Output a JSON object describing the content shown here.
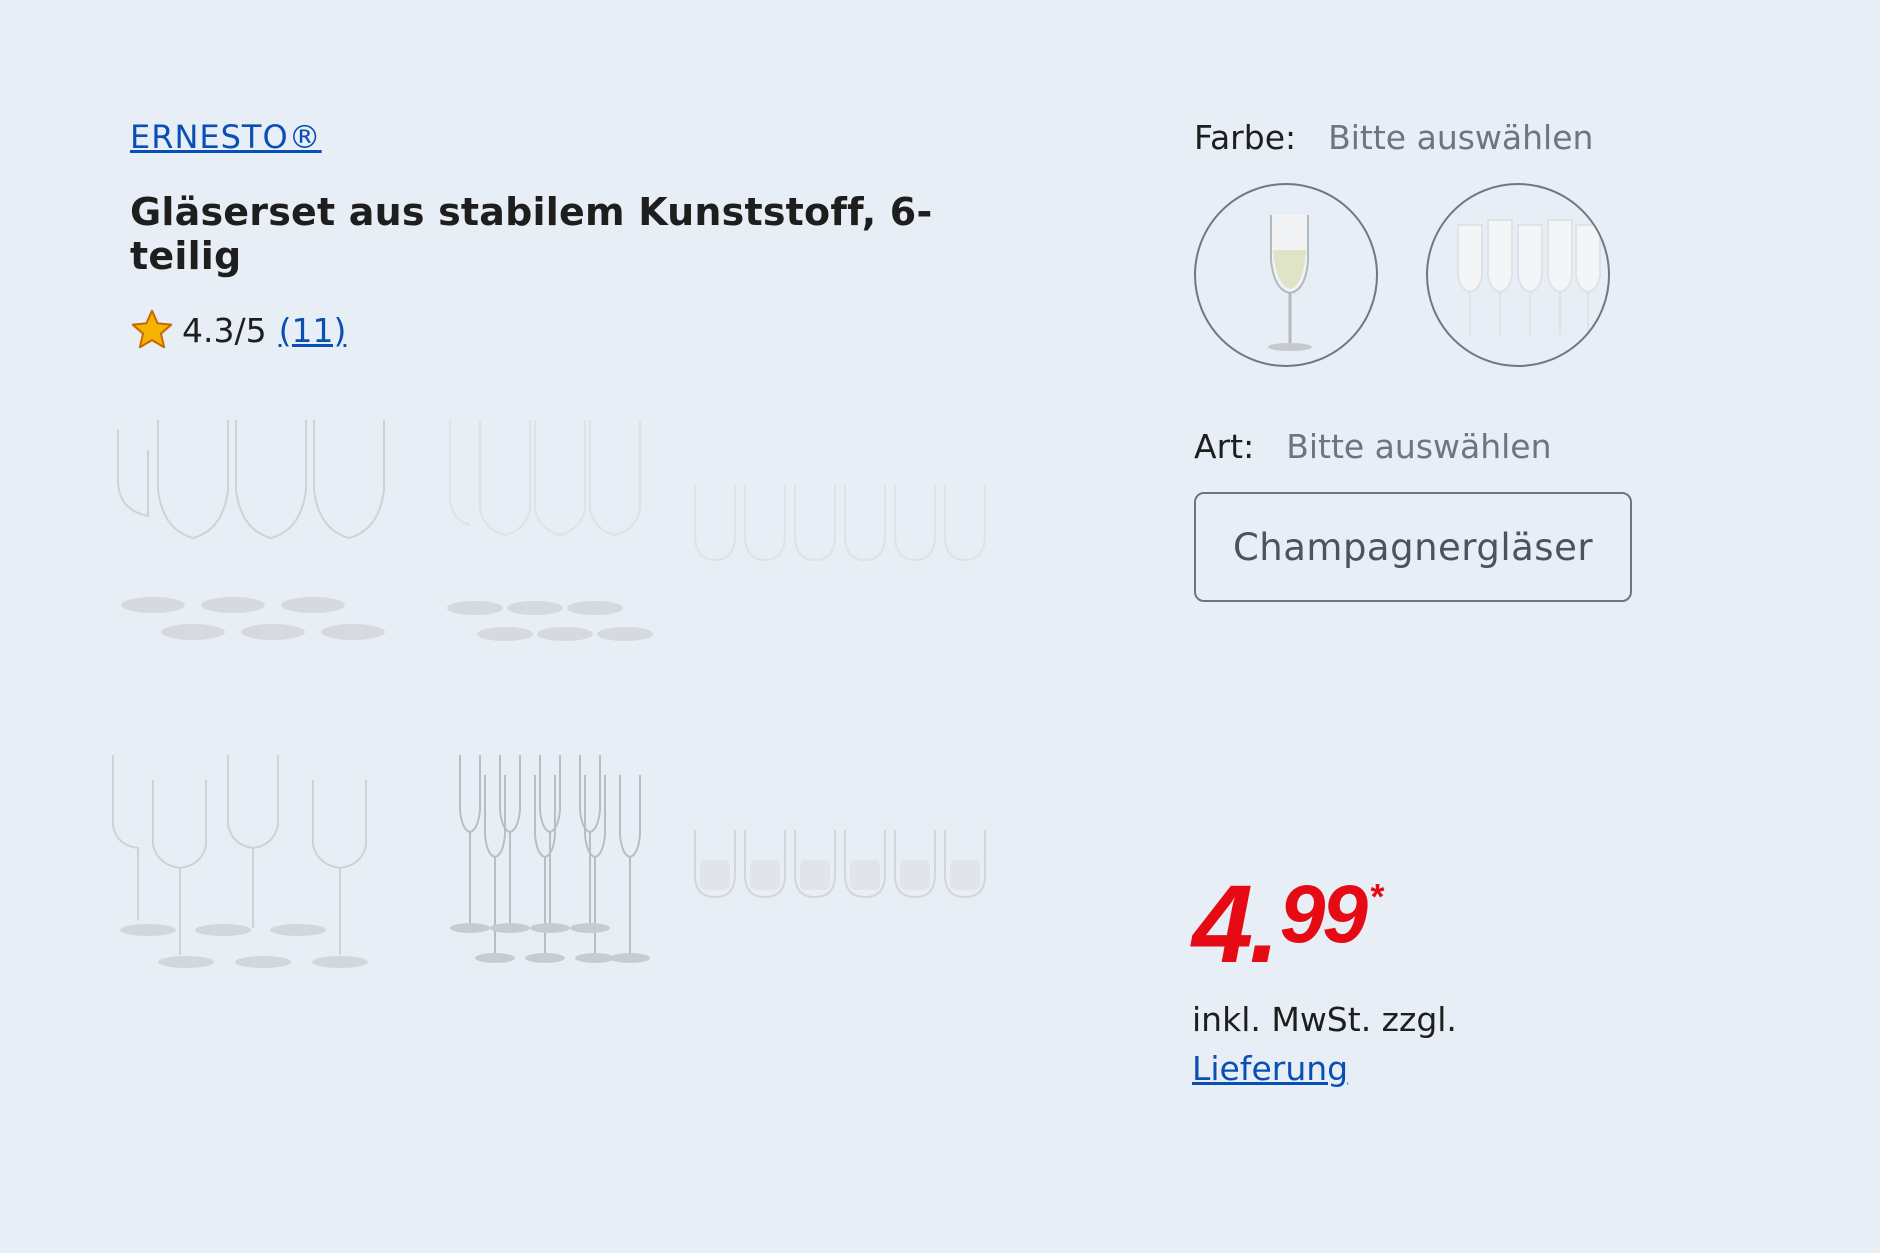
{
  "product": {
    "brand": "ERNESTO®",
    "title": "Gläserset aus stabilem Kunststoff, 6-teilig",
    "rating": {
      "score_text": "4.3/5",
      "count_text": "(11)",
      "value": 4.3,
      "max": 5
    }
  },
  "gallery": {
    "items": [
      "wine-glasses-large",
      "white-wine-glasses",
      "tumblers-short",
      "wine-glasses-slim",
      "champagne-flutes",
      "tumblers-small"
    ]
  },
  "options": {
    "color": {
      "label": "Farbe:",
      "hint": "Bitte auswählen",
      "swatches": [
        "single-glass-swatch",
        "glass-set-swatch"
      ]
    },
    "type": {
      "label": "Art:",
      "hint": "Bitte auswählen",
      "selected": "Champagnergläser"
    }
  },
  "price": {
    "integer": "4",
    "separator": ".",
    "decimals": "99",
    "asterisk": "*",
    "tax_note": "inkl. MwSt. zzgl.",
    "delivery_link": "Lieferung"
  },
  "colors": {
    "background": "#e8eef6",
    "link": "#0a4fb4",
    "price": "#e60a14",
    "star": "#f5b301"
  }
}
